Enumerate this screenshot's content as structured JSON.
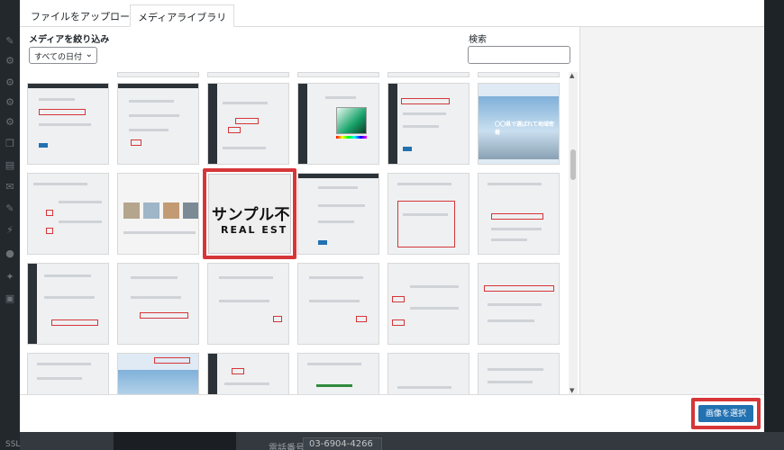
{
  "modal": {
    "tabs": [
      {
        "label": "ファイルをアップロード",
        "active": false
      },
      {
        "label": "メディアライブラリ",
        "active": true
      }
    ],
    "filter": {
      "title": "メディアを絞り込み",
      "date_value": "すべての日付"
    },
    "search": {
      "label": "検索",
      "value": ""
    },
    "selected_image": {
      "line1": "サンプル不",
      "line2": "REAL EST"
    },
    "thumb_texts": {
      "cityscape_caption": "〇〇県で選ばれて地域密着"
    },
    "select_button": "画像を選択"
  },
  "background": {
    "phone_label": "電話番号",
    "phone_value": "03-6904-4266",
    "sidebar_footer": "SSL"
  },
  "colors": {
    "accent": "#2271b1",
    "highlight": "#d63638"
  }
}
